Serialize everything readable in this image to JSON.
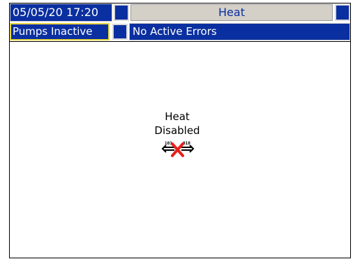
{
  "header": {
    "datetime": "05/05/20 17:20",
    "screen_title": "Heat"
  },
  "status_bar": {
    "pump_status": "Pumps Inactive",
    "error_status": "No Active Errors"
  },
  "main": {
    "heat_status_line1": "Heat",
    "heat_status_line2": "Disabled",
    "icon": "heat-disabled-icon",
    "icon_left_digits": "101",
    "icon_right_digits": "010"
  },
  "colors": {
    "header_blue": "#0a2fa0",
    "title_gray": "#d4d0c8",
    "selected_border": "#e8d640",
    "disabled_x": "#e8211a"
  }
}
